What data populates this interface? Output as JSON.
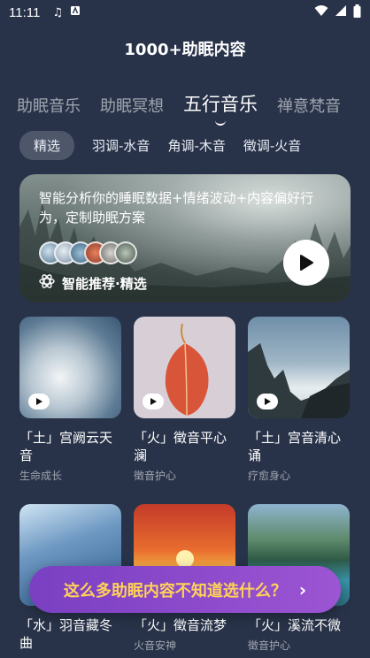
{
  "status_bar": {
    "time": "11:11",
    "icons": [
      "music-note-icon",
      "app-badge-icon",
      "wifi-icon",
      "signal-icon",
      "battery-icon"
    ]
  },
  "header": {
    "title": "1000+助眠内容"
  },
  "tabs": [
    {
      "label": "助眠音乐",
      "active": false
    },
    {
      "label": "助眠冥想",
      "active": false
    },
    {
      "label": "五行音乐",
      "active": true
    },
    {
      "label": "禅意梵音",
      "active": false
    }
  ],
  "chips": [
    {
      "label": "精选",
      "selected": true
    },
    {
      "label": "羽调-水音",
      "selected": false
    },
    {
      "label": "角调-木音",
      "selected": false
    },
    {
      "label": "徵调-火音",
      "selected": false
    }
  ],
  "banner": {
    "text": "智能分析你的睡眠数据+情绪波动+内容偏好行为，定制助眠方案",
    "tag": "智能推荐·精选",
    "tag_icon": "atom-icon",
    "play_icon": "play-icon"
  },
  "cards": [
    {
      "title": "「土」宫阙云天音",
      "subtitle": "生命成长",
      "image": "clouds"
    },
    {
      "title": "「火」徵音平心澜",
      "subtitle": "徵音护心",
      "image": "leaf"
    },
    {
      "title": "「土」宫音清心诵",
      "subtitle": "疗愈身心",
      "image": "mountain"
    },
    {
      "title": "「水」羽音藏冬曲",
      "subtitle": "",
      "image": "water"
    },
    {
      "title": "「火」徵音流梦",
      "subtitle": "火音安神",
      "image": "sunset"
    },
    {
      "title": "「火」溪流不微",
      "subtitle": "徵音护心",
      "image": "lake"
    }
  ],
  "cta": {
    "label": "这么多助眠内容不知道选什么？",
    "arrow": "›"
  },
  "colors": {
    "background": "#283349",
    "accent": "#ffd257",
    "cta_gradient_start": "#7a3fc2",
    "cta_gradient_end": "#9c55d3"
  }
}
